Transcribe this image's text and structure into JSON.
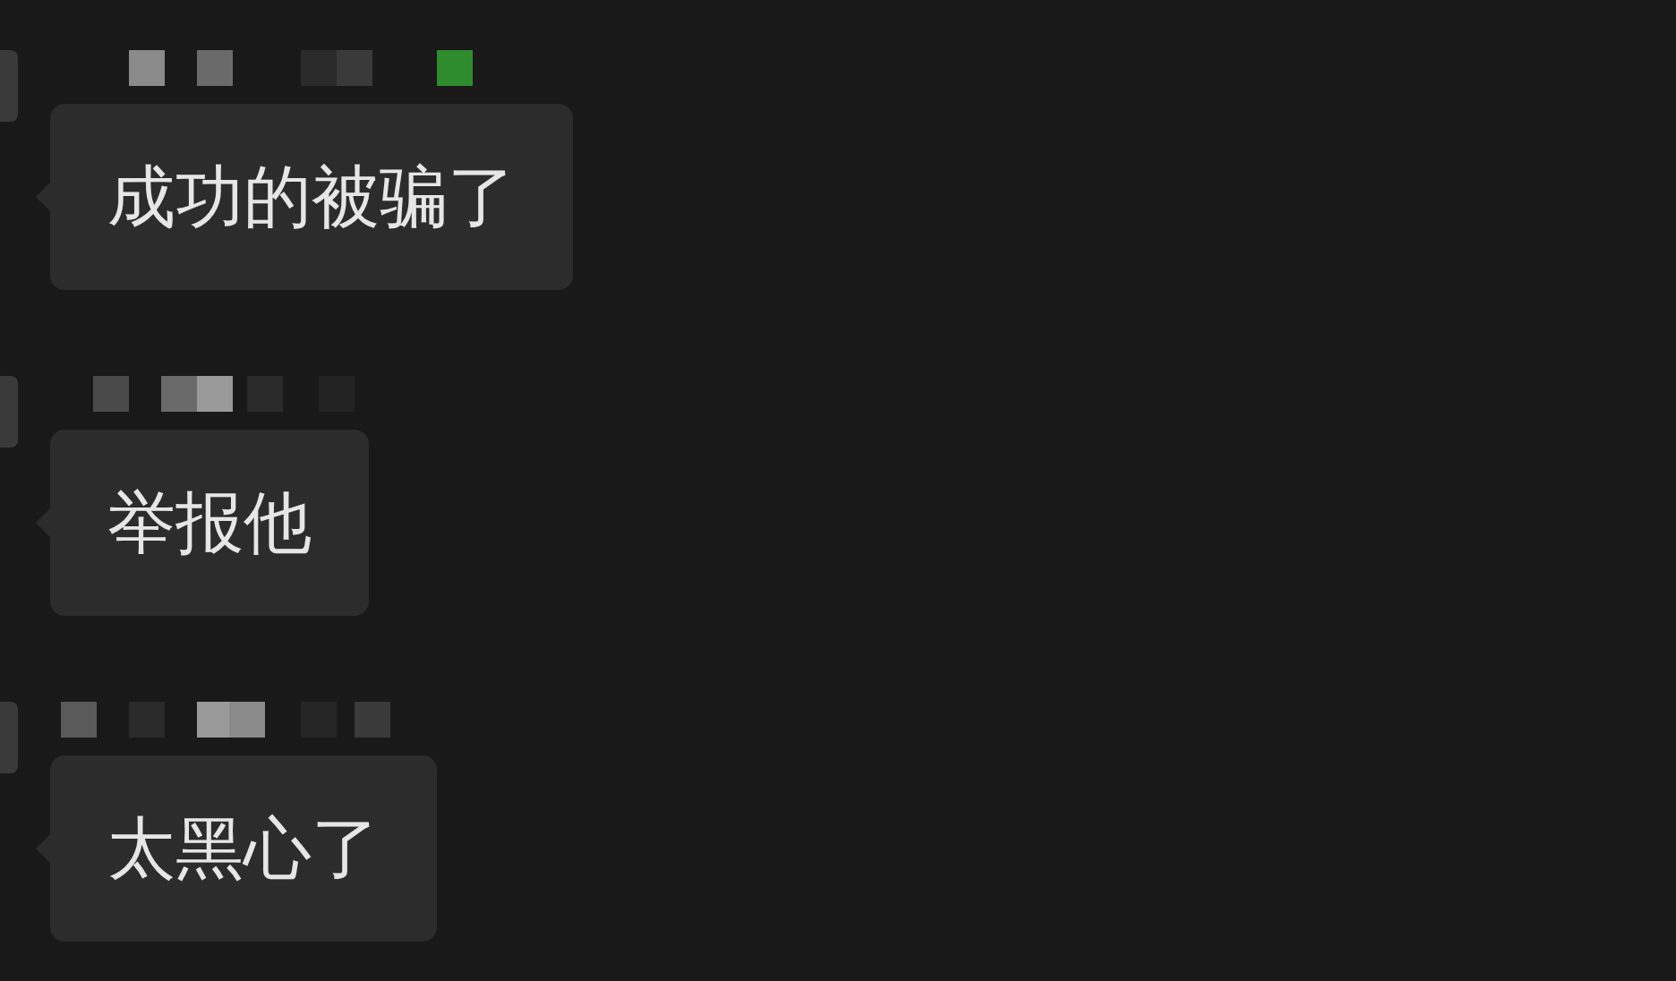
{
  "messages": [
    {
      "text": "成功的被骗了"
    },
    {
      "text": "举报他"
    },
    {
      "text": "太黑心了"
    }
  ]
}
